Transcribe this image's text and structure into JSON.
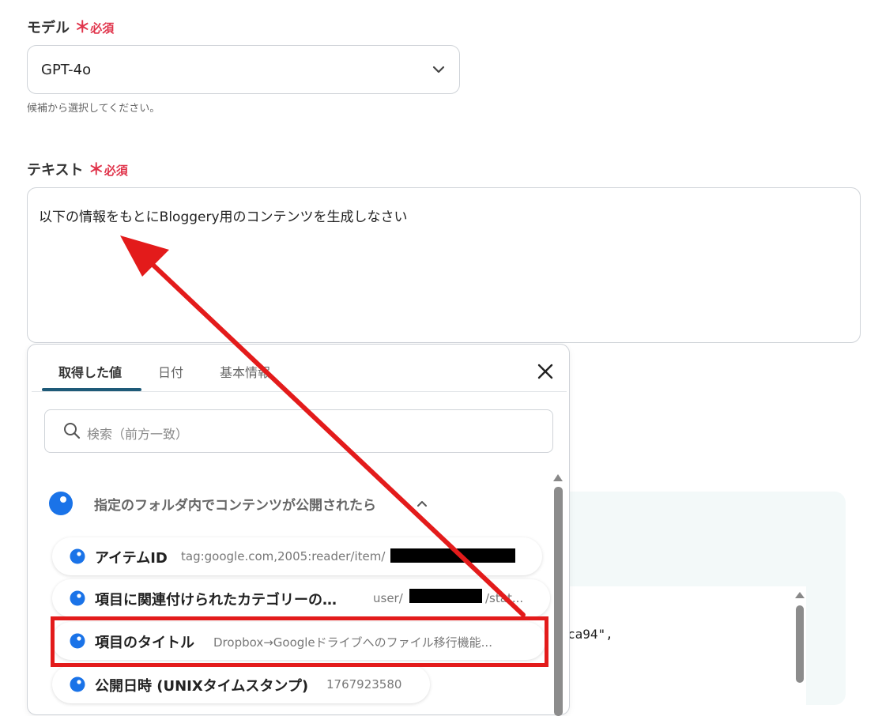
{
  "model": {
    "label": "モデル",
    "required_star": "＊",
    "required_text": "必須",
    "value": "GPT-4o",
    "help": "候補から選択してください。"
  },
  "text_field": {
    "label": "テキスト",
    "required_star": "＊",
    "required_text": "必須",
    "value": "以下の情報をもとにBloggery用のコンテンツを生成しなさい"
  },
  "background": {
    "code_fragment": "ca94\","
  },
  "popup": {
    "tabs": [
      {
        "label": "取得した値"
      },
      {
        "label": "日付"
      },
      {
        "label": "基本情報"
      }
    ],
    "search_placeholder": "検索（前方一致）",
    "group_title": "指定のフォルダ内でコンテンツが公開されたら",
    "items": [
      {
        "name": "アイテムID",
        "value": "tag:google.com,2005:reader/item/"
      },
      {
        "name": "項目に関連付けられたカテゴリーの…",
        "value": "user/",
        "value_suffix": "/stat..."
      },
      {
        "name": "項目のタイトル",
        "value": "Dropbox→Googleドライブへのファイル移行機能..."
      },
      {
        "name": "公開日時 (UNIXタイムスタンプ)",
        "value": "1767923580"
      }
    ]
  },
  "colors": {
    "accent": "#1e5a78",
    "required": "#e0344b",
    "annotation": "#e31b1b",
    "item_dot": "#1a73e8"
  }
}
